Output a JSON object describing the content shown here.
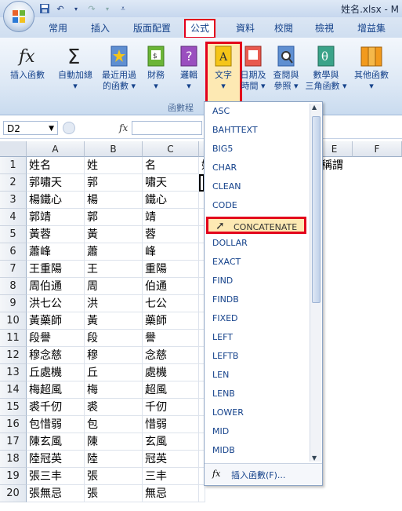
{
  "window": {
    "title": "姓名.xlsx - M"
  },
  "tabs": [
    "常用",
    "插入",
    "版面配置",
    "公式",
    "資料",
    "校閱",
    "檢視",
    "增益集"
  ],
  "ribbon": {
    "buttons": [
      {
        "label1": "插入函數",
        "label2": ""
      },
      {
        "label1": "自動加總",
        "label2": "▾"
      },
      {
        "label1": "最近用過",
        "label2": "的函數 ▾"
      },
      {
        "label1": "財務",
        "label2": "▾"
      },
      {
        "label1": "邏輯",
        "label2": "▾"
      },
      {
        "label1": "文字",
        "label2": "▾"
      },
      {
        "label1": "日期及",
        "label2": "時間 ▾"
      },
      {
        "label1": "查閱與",
        "label2": "參照 ▾"
      },
      {
        "label1": "數學與",
        "label2": "三角函數 ▾"
      },
      {
        "label1": "其他函數",
        "label2": "▾"
      }
    ],
    "group_label": "函數程"
  },
  "formula_bar": {
    "name_box": "D2",
    "fx": "fx"
  },
  "columns": [
    "A",
    "B",
    "C",
    "",
    "",
    "E",
    "F"
  ],
  "rows": [
    [
      "姓名",
      "姓",
      "名",
      "姓"
    ],
    [
      "郭嘯天",
      "郭",
      "嘯天",
      ""
    ],
    [
      "楊鐵心",
      "楊",
      "鐵心",
      ""
    ],
    [
      "郭靖",
      "郭",
      "靖",
      ""
    ],
    [
      "黃蓉",
      "黃",
      "蓉",
      ""
    ],
    [
      "蕭峰",
      "蕭",
      "峰",
      ""
    ],
    [
      "王重陽",
      "王",
      "重陽",
      ""
    ],
    [
      "周伯通",
      "周",
      "伯通",
      ""
    ],
    [
      "洪七公",
      "洪",
      "七公",
      ""
    ],
    [
      "黃藥師",
      "黃",
      "藥師",
      ""
    ],
    [
      "段譽",
      "段",
      "譽",
      ""
    ],
    [
      "穆念慈",
      "穆",
      "念慈",
      ""
    ],
    [
      "丘處機",
      "丘",
      "處機",
      ""
    ],
    [
      "梅超風",
      "梅",
      "超風",
      ""
    ],
    [
      "裘千仞",
      "裘",
      "千仞",
      ""
    ],
    [
      "包惜弱",
      "包",
      "惜弱",
      ""
    ],
    [
      "陳玄風",
      "陳",
      "玄風",
      ""
    ],
    [
      "陸冠英",
      "陸",
      "冠英",
      ""
    ],
    [
      "張三丰",
      "張",
      "三丰",
      ""
    ],
    [
      "張無忌",
      "張",
      "無忌",
      ""
    ]
  ],
  "e1_text": "稱謂",
  "dropdown": {
    "items": [
      "ASC",
      "BAHTTEXT",
      "BIG5",
      "CHAR",
      "CLEAN",
      "CODE",
      "CONCATENATE",
      "DOLLAR",
      "EXACT",
      "FIND",
      "FINDB",
      "FIXED",
      "LEFT",
      "LEFTB",
      "LEN",
      "LENB",
      "LOWER",
      "MID",
      "MIDB"
    ],
    "highlighted": "CONCATENATE",
    "footer": "插入函數(F)..."
  },
  "colors": {
    "highlight_border": "#e3001b",
    "highlight_fill": "#fde9b3"
  }
}
